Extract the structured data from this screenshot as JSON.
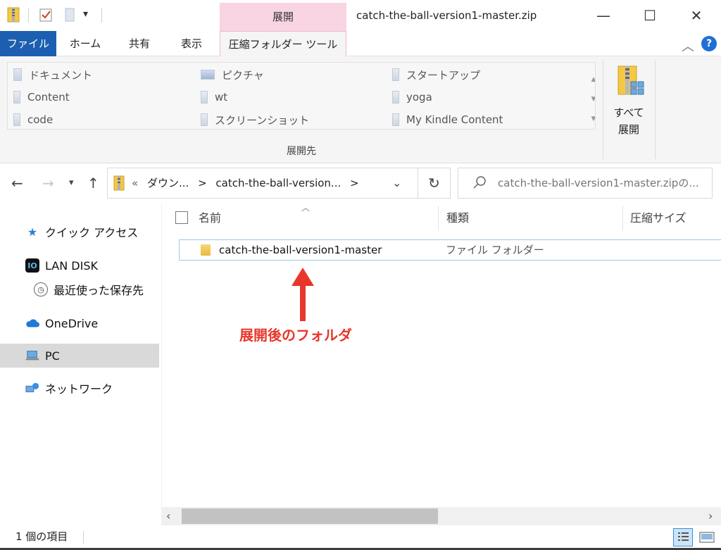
{
  "window": {
    "title": "catch-the-ball-version1-master.zip",
    "context_tab_header": "展開",
    "minimize_glyph": "—",
    "maximize_glyph": "☐",
    "close_glyph": "✕"
  },
  "ribbon_tabs": {
    "file": "ファイル",
    "home": "ホーム",
    "share": "共有",
    "view": "表示",
    "compressed_tools": "圧縮フォルダー ツール"
  },
  "ribbon": {
    "destinations": [
      "ドキュメント",
      "ピクチャ",
      "スタートアップ",
      "Content",
      "wt",
      "yoga",
      "code",
      "スクリーンショット",
      "My Kindle Content"
    ],
    "group_label": "展開先",
    "extract_all_label": "すべて\n展開"
  },
  "address": {
    "overflow": "«",
    "crumbs": [
      "ダウン...",
      "catch-the-ball-version..."
    ],
    "separator": ">",
    "search_placeholder": "catch-the-ball-version1-master.zipの..."
  },
  "nav_pane": {
    "items": [
      {
        "label": "クイック アクセス",
        "icon": "star-icon"
      },
      {
        "label": "LAN DISK",
        "icon": "lan-disk-icon"
      },
      {
        "label": "最近使った保存先",
        "icon": "clock-icon"
      },
      {
        "label": "OneDrive",
        "icon": "cloud-icon"
      },
      {
        "label": "PC",
        "icon": "pc-icon",
        "selected": true
      },
      {
        "label": "ネットワーク",
        "icon": "network-icon"
      }
    ]
  },
  "columns": {
    "name": "名前",
    "type": "種類",
    "compressed_size": "圧縮サイズ"
  },
  "rows": [
    {
      "name": "catch-the-ball-version1-master",
      "type": "ファイル フォルダー"
    }
  ],
  "annotation": {
    "label": "展開後のフォルダ",
    "color": "#e8372a"
  },
  "status": {
    "item_count": "1 個の項目"
  },
  "colors": {
    "file_tab": "#1c5fb0",
    "context_tab": "#f9d4e2",
    "selection_border": "#99c9ef"
  }
}
